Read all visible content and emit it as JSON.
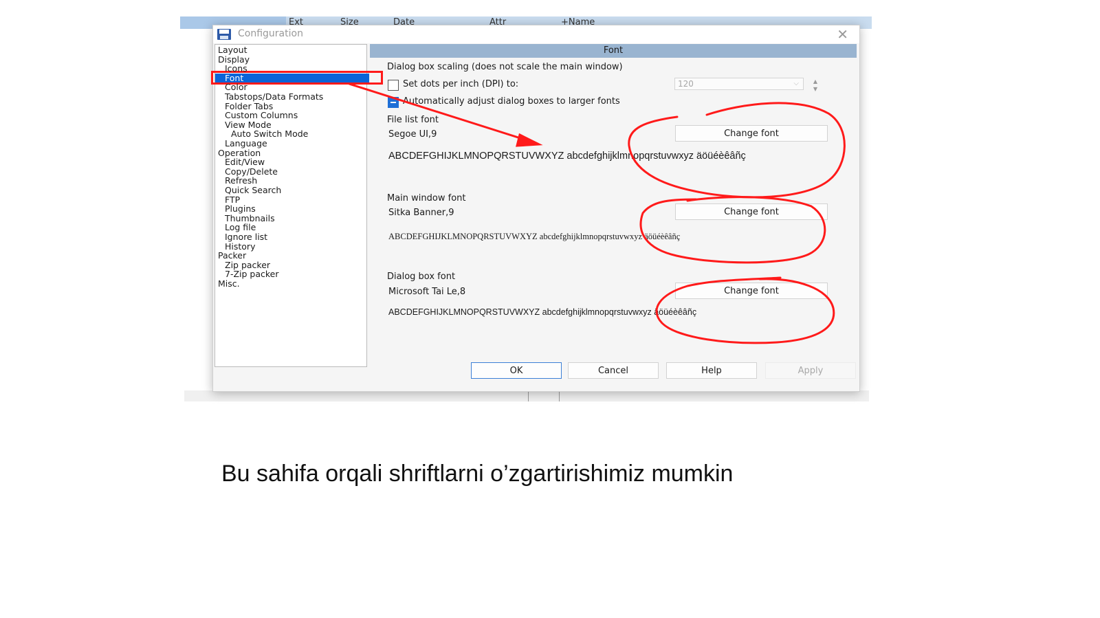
{
  "background": {
    "columns": [
      "Ext",
      "Size",
      "Date",
      "Attr",
      "+Name"
    ]
  },
  "dialog": {
    "title": "Configuration",
    "close_glyph": "✕",
    "tree": [
      {
        "label": "Layout",
        "level": 0
      },
      {
        "label": "Display",
        "level": 0
      },
      {
        "label": "Icons",
        "level": 1
      },
      {
        "label": "Font",
        "level": 1,
        "selected": true
      },
      {
        "label": "Color",
        "level": 1
      },
      {
        "label": "Tabstops/Data Formats",
        "level": 1
      },
      {
        "label": "Folder Tabs",
        "level": 1
      },
      {
        "label": "Custom Columns",
        "level": 1
      },
      {
        "label": "View Mode",
        "level": 1
      },
      {
        "label": "Auto Switch Mode",
        "level": 2
      },
      {
        "label": "Language",
        "level": 1
      },
      {
        "label": "Operation",
        "level": 0
      },
      {
        "label": "Edit/View",
        "level": 1
      },
      {
        "label": "Copy/Delete",
        "level": 1
      },
      {
        "label": "Refresh",
        "level": 1
      },
      {
        "label": "Quick Search",
        "level": 1
      },
      {
        "label": "FTP",
        "level": 1
      },
      {
        "label": "Plugins",
        "level": 1
      },
      {
        "label": "Thumbnails",
        "level": 1
      },
      {
        "label": "Log file",
        "level": 1
      },
      {
        "label": "Ignore list",
        "level": 1
      },
      {
        "label": "History",
        "level": 1
      },
      {
        "label": "Packer",
        "level": 0
      },
      {
        "label": "Zip packer",
        "level": 1
      },
      {
        "label": "7-Zip packer",
        "level": 1
      },
      {
        "label": "Misc.",
        "level": 0
      }
    ],
    "panel": {
      "header": "Font",
      "scaling_label": "Dialog box scaling (does not scale the main window)",
      "dpi_checkbox_label": "Set dots per inch (DPI) to:",
      "dpi_checked": false,
      "dpi_value": "120",
      "auto_adjust_label": "Automatically adjust dialog boxes to larger fonts",
      "auto_adjust_checked": true,
      "file_list": {
        "label": "File list font",
        "font": "Segoe UI,9",
        "button": "Change font",
        "sample": "ABCDEFGHIJKLMNOPQRSTUVWXYZ abcdefghijklmnopqrstuvwxyz äöüéèêâñç"
      },
      "main_window": {
        "label": "Main window font",
        "font": "Sitka Banner,9",
        "button": "Change font",
        "sample": "ABCDEFGHIJKLMNOPQRSTUVWXYZ abcdefghijklmnopqrstuvwxyz äöüéèêâñç"
      },
      "dialog_box": {
        "label": "Dialog box font",
        "font": "Microsoft Tai Le,8",
        "button": "Change font",
        "sample": "ABCDEFGHIJKLMNOPQRSTUVWXYZ abcdefghijklmnopqrstuvwxyz äöüéèêâñç"
      }
    },
    "buttons": {
      "ok": "OK",
      "cancel": "Cancel",
      "help": "Help",
      "apply": "Apply"
    }
  },
  "annotation_color": "#ff1a1a",
  "highlight_color": "#0a64d8",
  "caption": "Bu sahifa orqali shriftlarni o’zgartirishimiz mumkin"
}
